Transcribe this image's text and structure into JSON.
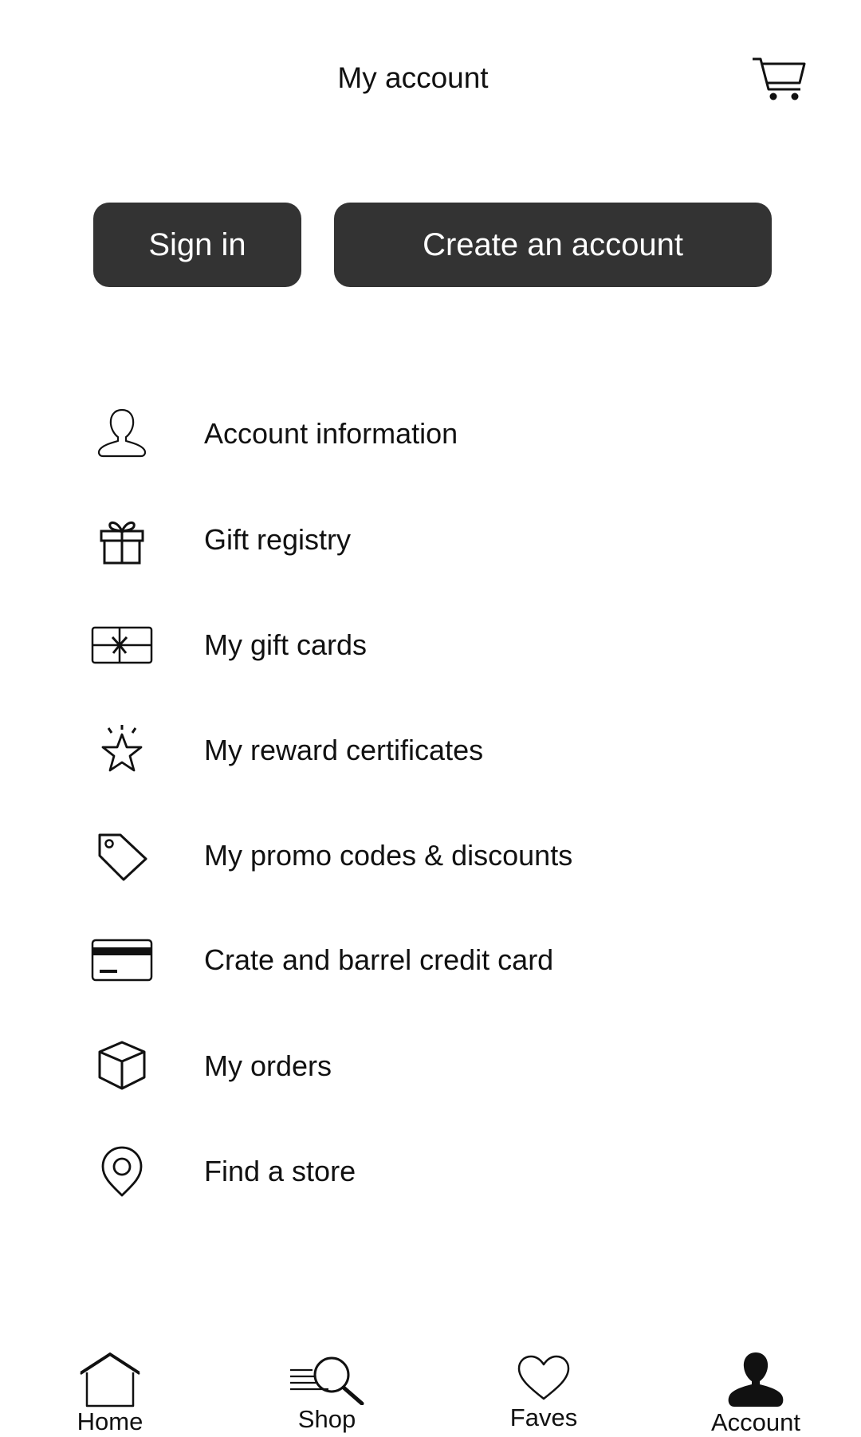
{
  "header": {
    "title": "My account",
    "cart_icon": "cart-icon"
  },
  "auth": {
    "sign_in_label": "Sign in",
    "create_account_label": "Create an account",
    "button_color": "#333333"
  },
  "menu": {
    "items": [
      {
        "label": "Account information",
        "icon": "user-icon"
      },
      {
        "label": "Gift registry",
        "icon": "gift-icon"
      },
      {
        "label": "My gift cards",
        "icon": "gift-card-icon"
      },
      {
        "label": "My reward certificates",
        "icon": "star-icon"
      },
      {
        "label": "My promo codes & discounts",
        "icon": "tag-icon"
      },
      {
        "label": "Crate and barrel credit card",
        "icon": "credit-card-icon"
      },
      {
        "label": "My orders",
        "icon": "box-icon"
      },
      {
        "label": "Find a store",
        "icon": "location-pin-icon"
      }
    ]
  },
  "bottom_nav": {
    "items": [
      {
        "label": "Home",
        "icon": "home-icon"
      },
      {
        "label": "Shop",
        "icon": "search-icon"
      },
      {
        "label": "Faves",
        "icon": "heart-icon"
      },
      {
        "label": "Account",
        "icon": "account-icon",
        "active": true
      }
    ]
  }
}
